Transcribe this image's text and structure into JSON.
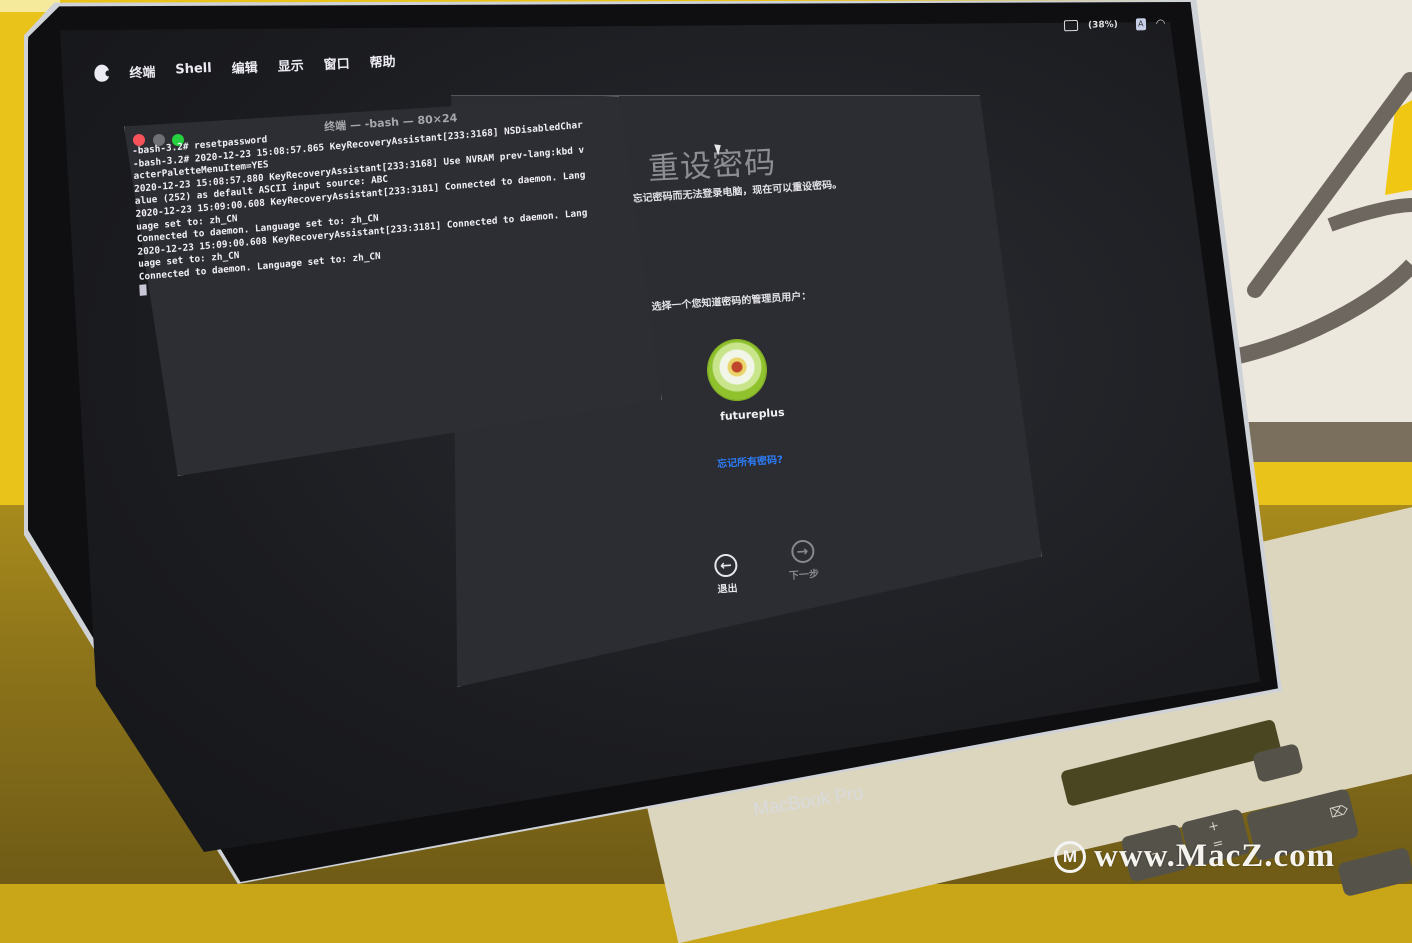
{
  "menubar": {
    "apple_icon": "apple-logo-icon",
    "items": [
      "终端",
      "Shell",
      "编辑",
      "显示",
      "窗口",
      "帮助"
    ]
  },
  "status": {
    "battery_icon": "battery-icon",
    "battery_percent": "(38%)",
    "input_source": "A",
    "wifi_icon": "wifi-icon"
  },
  "terminal": {
    "title": "终端 — -bash — 80×24",
    "lines": [
      "-bash-3.2# resetpassword",
      "-bash-3.2# 2020-12-23 15:08:57.865 KeyRecoveryAssistant[233:3168] NSDisabledChar",
      "acterPaletteMenuItem=YES",
      "2020-12-23 15:08:57.880 KeyRecoveryAssistant[233:3168] Use NVRAM prev-lang:kbd v",
      "alue (252) as default ASCII input source: ABC",
      "2020-12-23 15:09:00.608 KeyRecoveryAssistant[233:3181] Connected to daemon. Lang",
      "uage set to: zh_CN",
      "Connected to daemon. Language set to: zh_CN",
      "2020-12-23 15:09:00.608 KeyRecoveryAssistant[233:3181] Connected to daemon. Lang",
      "uage set to: zh_CN",
      "Connected to daemon. Language set to: zh_CN"
    ]
  },
  "reset_password": {
    "title": "重设密码",
    "description": "忘记密码而无法登录电脑，现在可以重设密码。",
    "prompt": "选择一个您知道密码的管理员用户：",
    "user": {
      "name": "futureplus",
      "avatar": "dandelion-avatar"
    },
    "forgot_link": "忘记所有密码?",
    "exit_label": "退出",
    "next_label": "下一步"
  },
  "hardware": {
    "model_label": "MacBook Pro"
  },
  "watermark": {
    "text": "www.MacZ.com",
    "logo": "M"
  },
  "colors": {
    "link": "#2d7dfb",
    "traffic_close": "#f5525a",
    "traffic_zoom": "#26d03f",
    "wall": "#e9c21a"
  }
}
